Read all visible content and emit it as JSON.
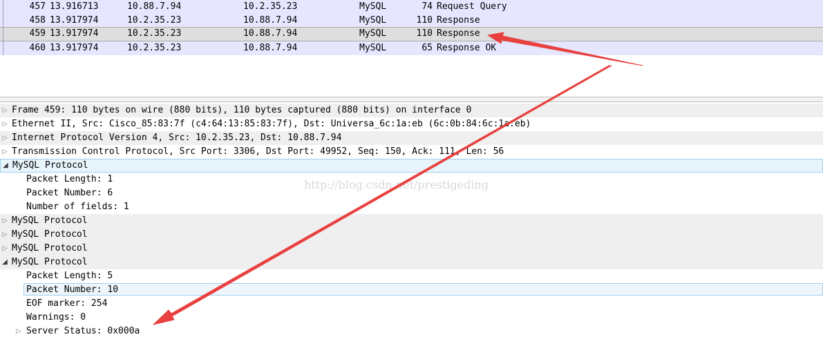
{
  "packet_list": [
    {
      "no": "457",
      "time": "13.916713",
      "source": "10.88.7.94",
      "destination": "10.2.35.23",
      "protocol": "MySQL",
      "length": "74",
      "info": "Request Query"
    },
    {
      "no": "458",
      "time": "13.917974",
      "source": "10.2.35.23",
      "destination": "10.88.7.94",
      "protocol": "MySQL",
      "length": "110",
      "info": "Response"
    },
    {
      "no": "459",
      "time": "13.917974",
      "source": "10.2.35.23",
      "destination": "10.88.7.94",
      "protocol": "MySQL",
      "length": "110",
      "info": "Response"
    },
    {
      "no": "460",
      "time": "13.917974",
      "source": "10.2.35.23",
      "destination": "10.88.7.94",
      "protocol": "MySQL",
      "length": "65",
      "info": "Response OK"
    }
  ],
  "details": {
    "frame": "Frame 459: 110 bytes on wire (880 bits), 110 bytes captured (880 bits) on interface 0",
    "ethernet": "Ethernet II, Src: Cisco_85:83:7f (c4:64:13:85:83:7f), Dst: Universa_6c:1a:eb (6c:0b:84:6c:1a:eb)",
    "ip": "Internet Protocol Version 4, Src: 10.2.35.23, Dst: 10.88.7.94",
    "tcp": "Transmission Control Protocol, Src Port: 3306, Dst Port: 49952, Seq: 150, Ack: 111, Len: 56",
    "mysql_1": "MySQL Protocol",
    "mysql_1_packet_length": "Packet Length: 1",
    "mysql_1_packet_number": "Packet Number: 6",
    "mysql_1_fields": "Number of fields: 1",
    "mysql_2": "MySQL Protocol",
    "mysql_3": "MySQL Protocol",
    "mysql_4": "MySQL Protocol",
    "mysql_5": "MySQL Protocol",
    "mysql_5_packet_length": "Packet Length: 5",
    "mysql_5_packet_number": "Packet Number: 10",
    "mysql_5_eof": "EOF marker: 254",
    "mysql_5_warnings": "Warnings: 0",
    "mysql_5_server_status": "Server Status: 0x000a"
  },
  "watermark": "http://blog.csdn.net/prestigeding",
  "colors": {
    "row_bg": "#e7e6ff",
    "row_selected": "#dedede",
    "annotation_arrow": "#e8413f"
  },
  "icons": {
    "collapsed": "triangle-right-icon",
    "expanded": "triangle-down-icon"
  }
}
